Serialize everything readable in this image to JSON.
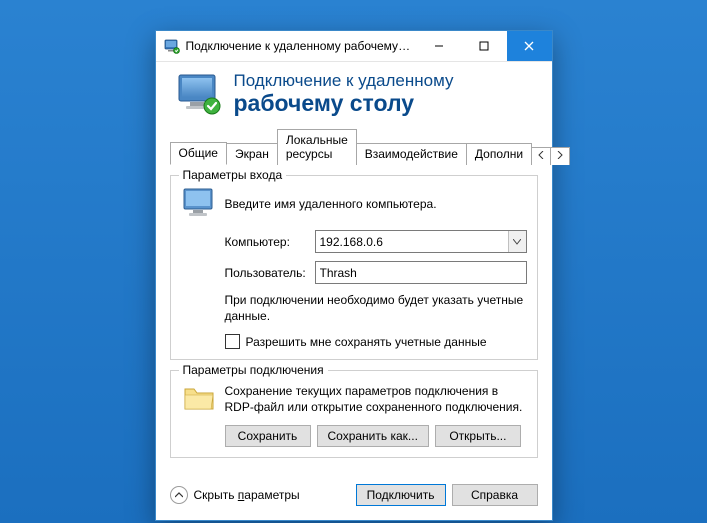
{
  "titlebar": {
    "text": "Подключение к удаленному рабочему с..."
  },
  "header": {
    "line1": "Подключение к удаленному",
    "line2": "рабочему столу"
  },
  "tabs": {
    "items": [
      "Общие",
      "Экран",
      "Локальные ресурсы",
      "Взаимодействие",
      "Дополни"
    ]
  },
  "login_group": {
    "title": "Параметры входа",
    "instruction": "Введите имя удаленного компьютера.",
    "computer_label": "Компьютер:",
    "computer_value": "192.168.0.6",
    "user_label": "Пользователь:",
    "user_value": "Thrash",
    "note": "При подключении необходимо будет указать учетные данные.",
    "checkbox_label": "Разрешить мне сохранять учетные данные"
  },
  "conn_group": {
    "title": "Параметры подключения",
    "desc": "Сохранение текущих параметров подключения в RDP-файл или открытие сохраненного подключения.",
    "save": "Сохранить",
    "save_as": "Сохранить как...",
    "open": "Открыть..."
  },
  "footer": {
    "hide_prefix": "Скрыть ",
    "hide_underlined": "п",
    "hide_suffix": "араметры",
    "connect": "Подключить",
    "help": "Справка"
  }
}
